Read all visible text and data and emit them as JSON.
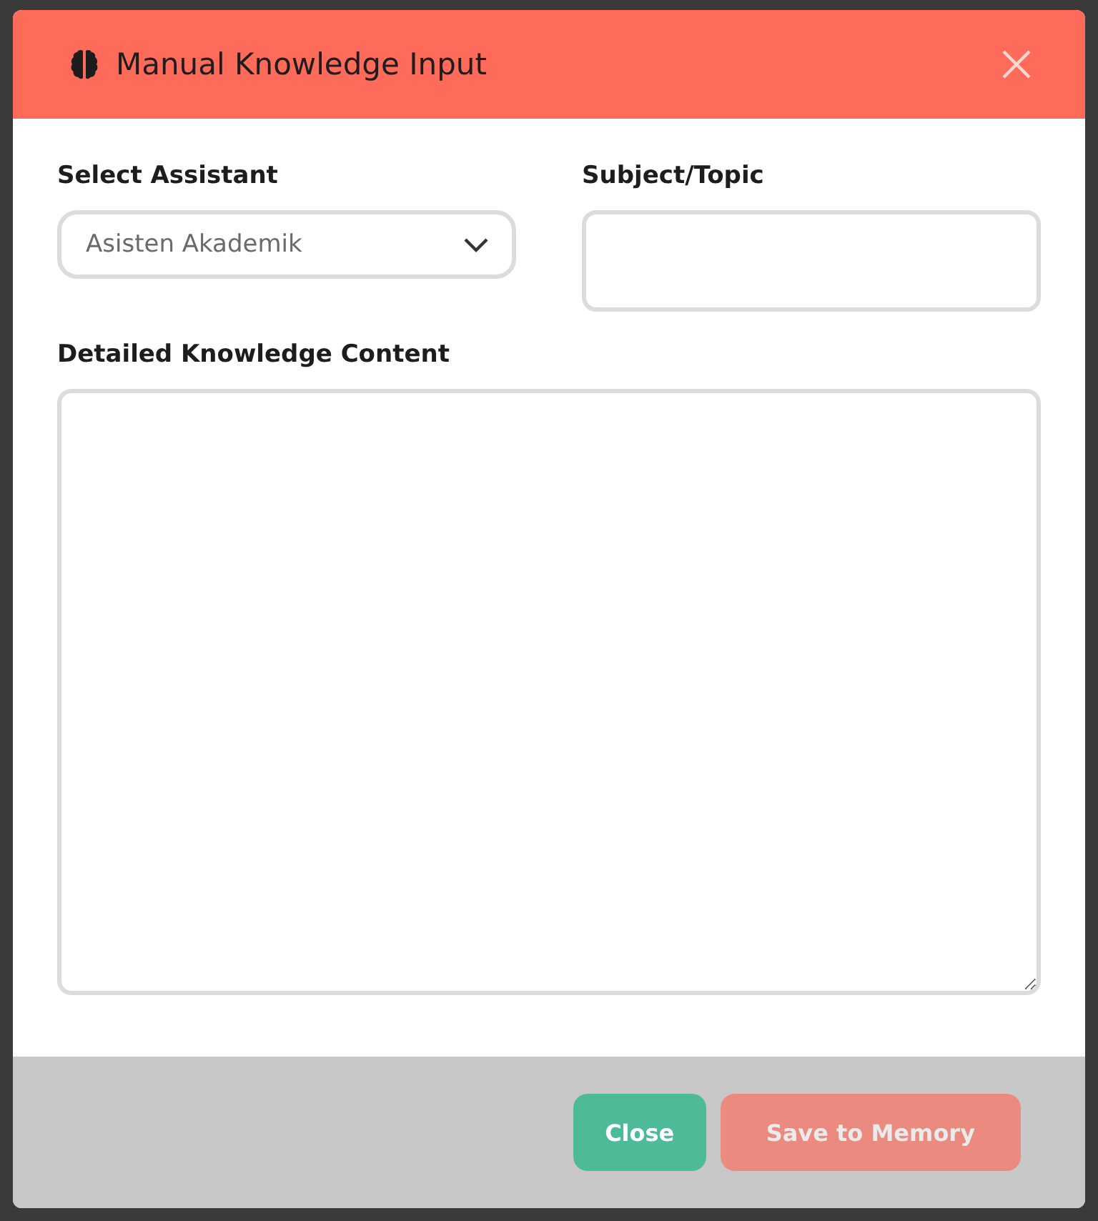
{
  "dialog": {
    "title": "Manual Knowledge Input"
  },
  "assistant_field": {
    "label": "Select Assistant",
    "value": "Asisten Akademik"
  },
  "subject_field": {
    "label": "Subject/Topic"
  },
  "content_field": {
    "label": "Detailed Knowledge Content"
  },
  "buttons": [
    {
      "kind": "secondary",
      "label": "Close",
      "disabled": false
    },
    {
      "kind": "primary",
      "label": "Save to Memory",
      "disabled": true
    }
  ]
}
